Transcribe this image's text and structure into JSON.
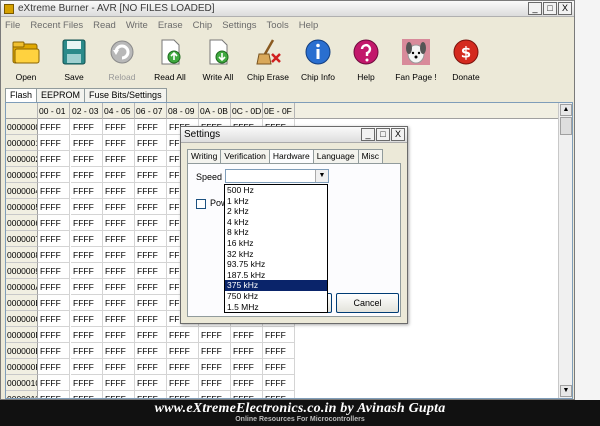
{
  "window": {
    "title": "eXtreme Burner - AVR [NO FILES LOADED]"
  },
  "window_buttons": [
    "_",
    "□",
    "X"
  ],
  "menu": [
    "File",
    "Recent Files",
    "Read",
    "Write",
    "Erase",
    "Chip",
    "Settings",
    "Tools",
    "Help"
  ],
  "toolbar": [
    {
      "label": "Open",
      "icon": "folder-icon",
      "enabled": true
    },
    {
      "label": "Save",
      "icon": "save-disk-icon",
      "enabled": true
    },
    {
      "label": "Reload",
      "icon": "reload-icon",
      "enabled": false
    },
    {
      "label": "Read All",
      "icon": "read-all-icon",
      "enabled": true
    },
    {
      "label": "Write All",
      "icon": "write-all-icon",
      "enabled": true
    },
    {
      "label": "Chip Erase",
      "icon": "broom-erase-icon",
      "enabled": true
    },
    {
      "label": "Chip Info",
      "icon": "info-icon",
      "enabled": true
    },
    {
      "label": "Help",
      "icon": "help-icon",
      "enabled": true
    },
    {
      "label": "Fan Page !",
      "icon": "dog-photo-icon",
      "enabled": true
    },
    {
      "label": "Donate",
      "icon": "dollar-icon",
      "enabled": true
    }
  ],
  "tabs": [
    "Flash",
    "EEPROM",
    "Fuse Bits/Settings"
  ],
  "grid": {
    "columns": [
      "00 - 01",
      "02 - 03",
      "04 - 05",
      "06 - 07",
      "08 - 09",
      "0A - 0B",
      "0C - 0D",
      "0E - 0F"
    ],
    "rows": [
      "00000000",
      "00000010",
      "00000020",
      "00000030",
      "00000040",
      "00000050",
      "00000060",
      "00000070",
      "00000080",
      "00000090",
      "000000A0",
      "000000B0",
      "000000C0",
      "000000D0",
      "000000E0",
      "000000F0",
      "00000100",
      "00000110"
    ],
    "cell_value": "FFFF"
  },
  "dialog": {
    "title": "Settings",
    "tabs": [
      "Writing",
      "Verification",
      "Hardware",
      "Language",
      "Misc"
    ],
    "active_tab": "Hardware",
    "speed_label": "Speed",
    "speed_value": "",
    "checkbox_label": "Pow",
    "speed_options": [
      "500 Hz",
      "1 kHz",
      "2 kHz",
      "4 kHz",
      "8 kHz",
      "16 kHz",
      "32 kHz",
      "93.75 kHz",
      "187.5 kHz",
      "375 kHz",
      "750 kHz",
      "1.5 MHz"
    ],
    "highlighted_option": "375 kHz",
    "cancel_label": "Cancel"
  },
  "banner": {
    "main": "www.eXtremeElectronics.co.in by Avinash Gupta",
    "sub": "Online Resources For Microcontrollers"
  },
  "colors": {
    "selection": "#0a246a",
    "window_bg": "#ece9d8",
    "banner_bg": "#111111"
  }
}
